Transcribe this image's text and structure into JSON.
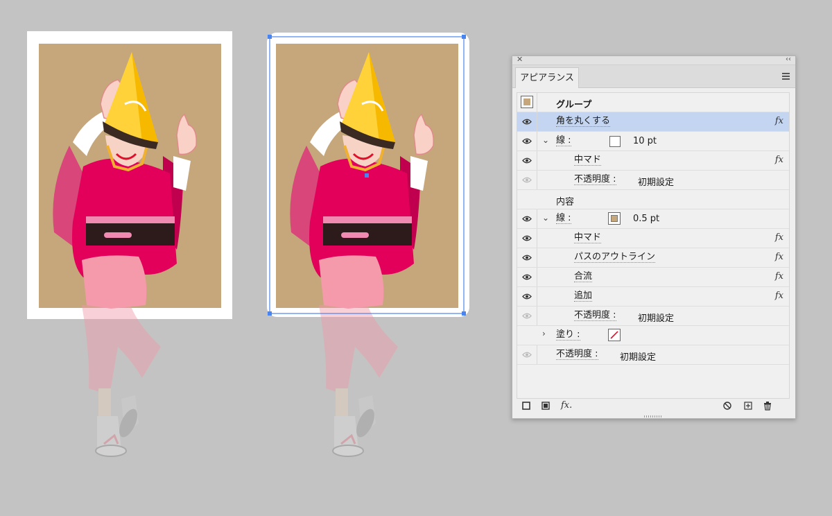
{
  "panel": {
    "tab_label": "アピアランス",
    "rows": {
      "group_label": "グループ",
      "round_corners": "角を丸くする",
      "stroke1_label": "線 :",
      "stroke1_value": "10 pt",
      "effect_center1": "中マド",
      "opacity1_label": "不透明度 :",
      "opacity1_value": "初期設定",
      "content_label": "内容",
      "stroke2_label": "線 :",
      "stroke2_value": "0.5 pt",
      "effect_center2": "中マド",
      "effect_outline": "パスのアウトライン",
      "effect_merge": "合流",
      "effect_add": "追加",
      "opacity2_label": "不透明度 :",
      "opacity2_value": "初期設定",
      "fill_label": "塗り :",
      "opacity3_label": "不透明度 :",
      "opacity3_value": "初期設定"
    },
    "fx_glyph": "fx",
    "bottom_fx": "fx."
  },
  "colors": {
    "canvas": "#c3c3c3",
    "artboard_bg": "#c6a77c",
    "kimono": "#e3005a",
    "selection": "#4a84ef",
    "row_selected": "#c3d5f0"
  },
  "icons": [
    "close-icon",
    "collapse-icon",
    "menu-icon",
    "eye-icon",
    "chevron-down-icon",
    "chevron-right-icon",
    "fx-icon",
    "new-stroke-icon",
    "new-fill-icon",
    "clear-icon",
    "duplicate-icon",
    "trash-icon"
  ]
}
